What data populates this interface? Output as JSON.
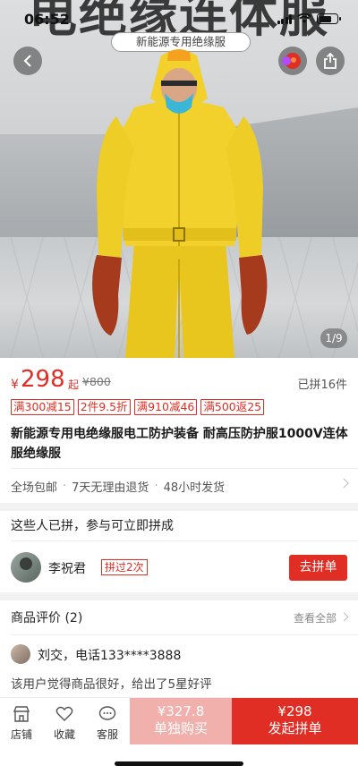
{
  "status_bar": {
    "time": "06:52"
  },
  "hero": {
    "banner": "电绝缘连体服",
    "sub_banner": "新能源专用绝缘服",
    "page_indicator": "1/9"
  },
  "product": {
    "currency": "¥",
    "price": "298",
    "price_suffix": "起",
    "original_price": "¥800",
    "sold": "已拼16件",
    "coupons": [
      "满300减15",
      "2件9.5折",
      "满910减46",
      "满500返25"
    ],
    "title": "新能源专用电绝缘服电工防护装备 耐高压防护服1000V连体服绝缘服",
    "services": [
      "全场包邮",
      "7天无理由退货",
      "48小时发货"
    ]
  },
  "group_buy": {
    "title": "这些人已拼，参与可立即拼成",
    "user_name": "李祝君",
    "badge": "拼过2次",
    "join_button": "去拼单"
  },
  "reviews": {
    "title": "商品评价 (2)",
    "view_all": "查看全部",
    "user": "刘交，电话133****3888",
    "text": "该用户觉得商品很好，给出了5星好评"
  },
  "bottom_bar": {
    "store": "店铺",
    "favorite": "收藏",
    "service": "客服",
    "buy_alone_price": "¥327.8",
    "buy_alone_label": "单独购买",
    "group_price": "¥298",
    "group_label": "发起拼单"
  },
  "colors": {
    "accent": "#e02e24",
    "accent_light": "#f2b0ad",
    "suit_yellow": "#f2d12c"
  },
  "icons": [
    "back-icon",
    "share-icon",
    "pdd-logo-icon",
    "store-icon",
    "heart-icon",
    "chat-icon",
    "chevron-right-icon"
  ]
}
